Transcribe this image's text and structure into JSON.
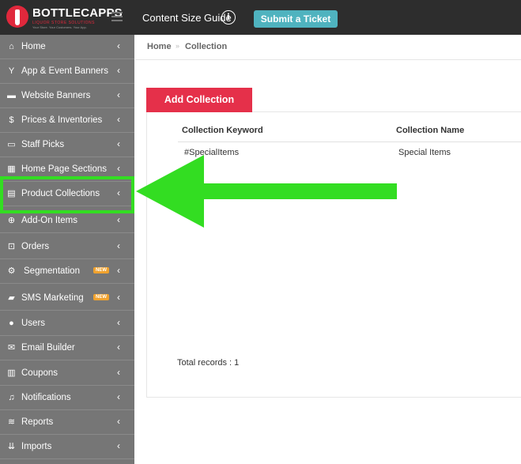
{
  "brand": {
    "name": "BOTTLECAPPS",
    "tagline": "LIQUOR STORE SOLUTIONS",
    "subtagline": "Your Store. Your Customers. Your App."
  },
  "topbar": {
    "content_guide": "Content Size Guide",
    "info_icon": "i",
    "ticket_button": "Submit a Ticket"
  },
  "sidebar": {
    "items": [
      {
        "label": "Home",
        "icon": "home-icon",
        "glyph": "⌂"
      },
      {
        "label": "App & Event Banners",
        "icon": "cocktail-icon",
        "glyph": "Y"
      },
      {
        "label": "Website Banners",
        "icon": "monitor-icon",
        "glyph": "▬"
      },
      {
        "label": "Prices & Inventories",
        "icon": "dollar-icon",
        "glyph": "$"
      },
      {
        "label": "Staff Picks",
        "icon": "card-icon",
        "glyph": "▭"
      },
      {
        "label": "Home Page Sections",
        "icon": "building-icon",
        "glyph": "▦"
      },
      {
        "label": "Product Collections",
        "icon": "calculator-icon",
        "glyph": "▤"
      },
      {
        "label": "Add-On Items",
        "icon": "plus-circle-icon",
        "glyph": "⊕"
      },
      {
        "label": "Orders",
        "icon": "cart-icon",
        "glyph": "⊡"
      },
      {
        "label": "Segmentation",
        "icon": "segmentation-icon",
        "glyph": "⚙",
        "badge": "NEW"
      },
      {
        "label": "SMS Marketing",
        "icon": "chat-icon",
        "glyph": "▰",
        "badge": "NEW"
      },
      {
        "label": "Users",
        "icon": "users-icon",
        "glyph": "●"
      },
      {
        "label": "Email Builder",
        "icon": "envelope-icon",
        "glyph": "✉"
      },
      {
        "label": "Coupons",
        "icon": "barcode-icon",
        "glyph": "▥"
      },
      {
        "label": "Notifications",
        "icon": "bell-icon",
        "glyph": "♫"
      },
      {
        "label": "Reports",
        "icon": "layers-icon",
        "glyph": "≋"
      },
      {
        "label": "Imports",
        "icon": "import-icon",
        "glyph": "⇊"
      }
    ],
    "chevron": "‹"
  },
  "breadcrumb": {
    "home": "Home",
    "separator": "»",
    "current": "Collection"
  },
  "main": {
    "add_button": "Add Collection",
    "columns": [
      "Collection Keyword",
      "Collection Name"
    ],
    "rows": [
      {
        "keyword": "#SpecialItems",
        "name": "Special Items"
      }
    ],
    "total": "Total records : 1"
  },
  "colors": {
    "topbar": "#2d2d2d",
    "sidebar": "#767676",
    "accent_red": "#e5304a",
    "ticket_teal": "#4fb3bf",
    "highlight_green": "#33dd22"
  }
}
